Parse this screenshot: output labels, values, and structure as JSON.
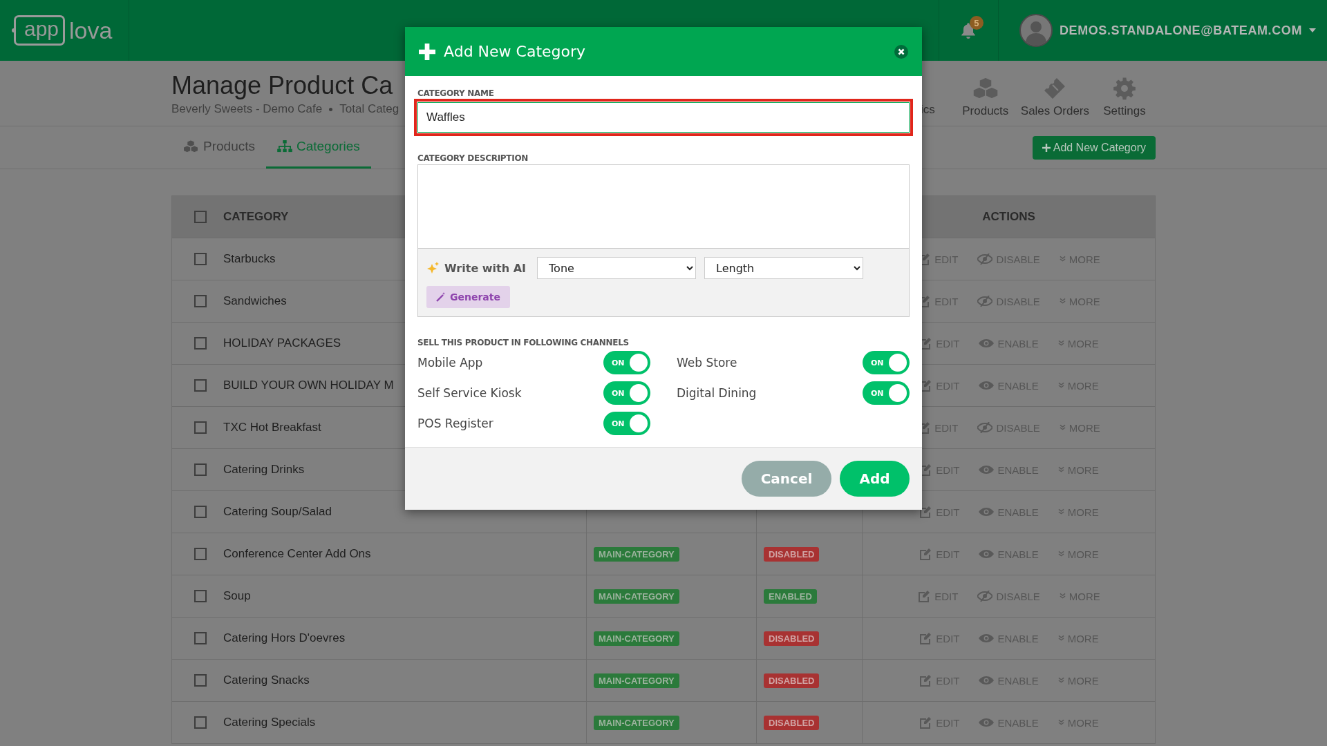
{
  "top_bar": {
    "logo_mark": "app",
    "logo_text": "lova",
    "notifications": "5",
    "user_email": "DEMOS.STANDALONE@BATEAM.COM"
  },
  "header": {
    "title": "Manage Product Ca",
    "store": "Beverly Sweets - Demo Cafe",
    "total": "Total Categ"
  },
  "nav": [
    {
      "label": "ics",
      "kind": "partial"
    },
    {
      "label": "Products",
      "kind": "products"
    },
    {
      "label": "Sales Orders",
      "kind": "orders"
    },
    {
      "label": "Settings",
      "kind": "settings"
    }
  ],
  "tabs": [
    {
      "label": "Products",
      "kind": "products",
      "selected": false
    },
    {
      "label": "Categories",
      "kind": "categories",
      "selected": true
    }
  ],
  "add_button": "Add New Category",
  "table": {
    "columns": [
      "CATEGORY",
      "ACTIONS"
    ],
    "all_checked": false,
    "rows": [
      {
        "name": "Starbucks",
        "checked": false,
        "enabled": true,
        "toggle_label": "DISABLE",
        "edit": "EDIT",
        "more": "MORE"
      },
      {
        "name": "Sandwiches",
        "checked": false,
        "enabled": true,
        "toggle_label": "DISABLE",
        "edit": "EDIT",
        "more": "MORE"
      },
      {
        "name": "HOLIDAY PACKAGES",
        "checked": false,
        "enabled": false,
        "toggle_label": "ENABLE",
        "edit": "EDIT",
        "more": "MORE"
      },
      {
        "name": "BUILD YOUR OWN HOLIDAY M",
        "checked": false,
        "enabled": false,
        "toggle_label": "ENABLE",
        "edit": "EDIT",
        "more": "MORE"
      },
      {
        "name": "TXC Hot Breakfast",
        "checked": false,
        "enabled": true,
        "toggle_label": "DISABLE",
        "edit": "EDIT",
        "more": "MORE"
      },
      {
        "name": "Catering Drinks",
        "checked": false,
        "enabled": false,
        "toggle_label": "ENABLE",
        "edit": "EDIT",
        "more": "MORE"
      },
      {
        "name": "Catering Soup/Salad",
        "checked": false,
        "enabled": false,
        "toggle_label": "ENABLE",
        "edit": "EDIT",
        "more": "MORE"
      },
      {
        "name": "Conference Center Add Ons",
        "checked": false,
        "type": "MAIN-CATEGORY",
        "status": "DISABLED",
        "enabled": false,
        "toggle_label": "ENABLE",
        "edit": "EDIT",
        "more": "MORE"
      },
      {
        "name": "Soup",
        "checked": false,
        "type": "MAIN-CATEGORY",
        "status": "ENABLED",
        "enabled": true,
        "toggle_label": "DISABLE",
        "edit": "EDIT",
        "more": "MORE"
      },
      {
        "name": "Catering Hors D'oevres",
        "checked": false,
        "type": "MAIN-CATEGORY",
        "status": "DISABLED",
        "enabled": false,
        "toggle_label": "ENABLE",
        "edit": "EDIT",
        "more": "MORE"
      },
      {
        "name": "Catering Snacks",
        "checked": false,
        "type": "MAIN-CATEGORY",
        "status": "DISABLED",
        "enabled": false,
        "toggle_label": "ENABLE",
        "edit": "EDIT",
        "more": "MORE"
      },
      {
        "name": "Catering Specials",
        "checked": false,
        "type": "MAIN-CATEGORY",
        "status": "DISABLED",
        "enabled": false,
        "toggle_label": "ENABLE",
        "edit": "EDIT",
        "more": "MORE"
      }
    ]
  },
  "modal": {
    "title": "Add New Category",
    "name_label": "CATEGORY NAME",
    "name_value": "Waffles",
    "description_label": "CATEGORY DESCRIPTION",
    "ai_label": "Write with AI",
    "tone": "Tone",
    "length": "Length",
    "generate": "Generate",
    "channels_label": "SELL THIS PRODUCT IN FOLLOWING CHANNELS",
    "channels": [
      {
        "name": "Mobile App",
        "on": true,
        "state_text": "ON"
      },
      {
        "name": "Web Store",
        "on": true,
        "state_text": "ON"
      },
      {
        "name": "Self Service Kiosk",
        "on": true,
        "state_text": "ON"
      },
      {
        "name": "Digital Dining",
        "on": true,
        "state_text": "ON"
      },
      {
        "name": "POS Register",
        "on": true,
        "state_text": "ON"
      }
    ],
    "cancel": "Cancel",
    "add": "Add"
  }
}
